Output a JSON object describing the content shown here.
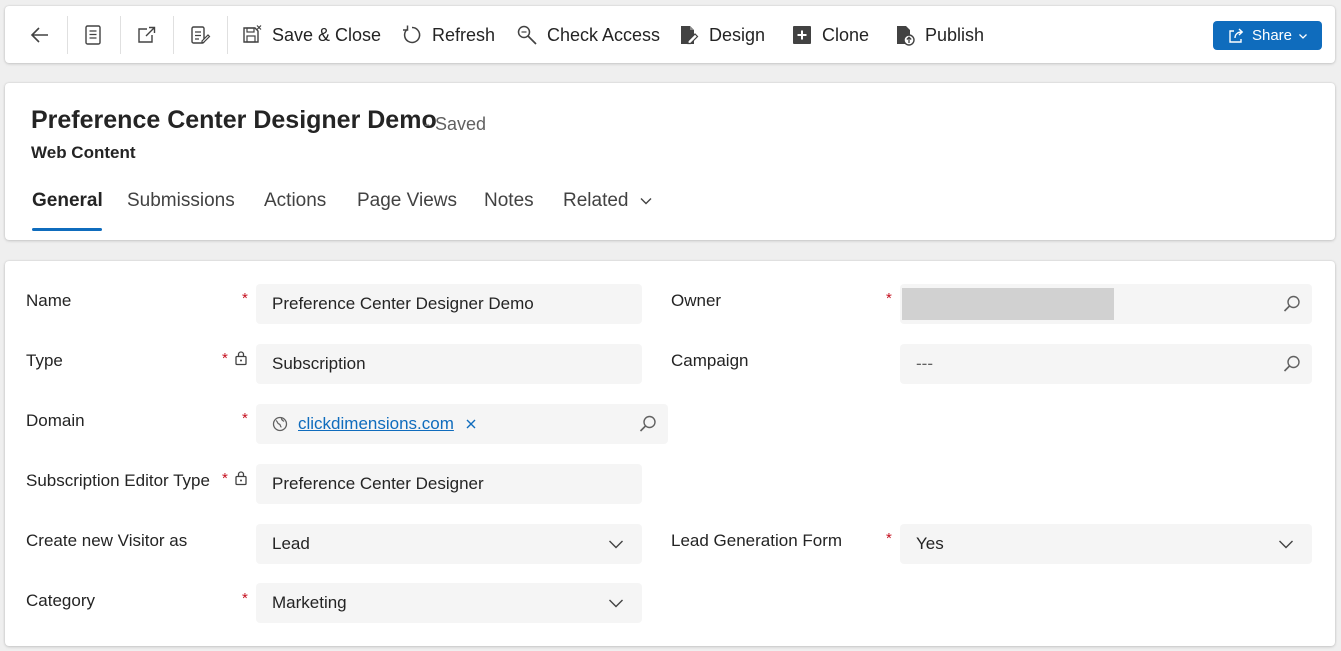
{
  "commandbar": {
    "back": "back-icon",
    "record_set": "record-set-icon",
    "open_new_window": "open-new-window-icon",
    "form_edit": "form-edit-icon",
    "buttons": [
      {
        "label": "Save & Close",
        "icon": "save-close-icon"
      },
      {
        "label": "Refresh",
        "icon": "refresh-icon"
      },
      {
        "label": "Check Access",
        "icon": "check-access-icon"
      },
      {
        "label": "Design",
        "icon": "design-icon"
      },
      {
        "label": "Clone",
        "icon": "clone-icon"
      },
      {
        "label": "Publish",
        "icon": "publish-icon"
      }
    ],
    "share": {
      "label": "Share",
      "icon": "share-icon",
      "color": "#0f6cbd"
    }
  },
  "header": {
    "title": "Preference Center Designer Demo",
    "status": "- Saved",
    "entity": "Web Content",
    "tabs": [
      {
        "label": "General",
        "active": true
      },
      {
        "label": "Submissions",
        "active": false
      },
      {
        "label": "Actions",
        "active": false
      },
      {
        "label": "Page Views",
        "active": false
      },
      {
        "label": "Notes",
        "active": false
      },
      {
        "label": "Related",
        "active": false
      }
    ],
    "accent": "#0f6cbd"
  },
  "form": {
    "required_mark": "*",
    "name": {
      "label": "Name",
      "value": "Preference Center Designer Demo"
    },
    "type": {
      "label": "Type",
      "value": "Subscription",
      "locked": true
    },
    "domain": {
      "label": "Domain",
      "value": "clickdimensions.com",
      "icon": "globe-icon"
    },
    "subscription_editor_type": {
      "label": "Subscription Editor Type",
      "value": "Preference Center Designer",
      "locked": true
    },
    "create_new_visitor_as": {
      "label": "Create new Visitor as",
      "value": "Lead"
    },
    "category": {
      "label": "Category",
      "value": "Marketing"
    },
    "owner": {
      "label": "Owner",
      "value": ""
    },
    "campaign": {
      "label": "Campaign",
      "value": "---"
    },
    "lead_generation_form": {
      "label": "Lead Generation Form",
      "value": "Yes"
    }
  }
}
